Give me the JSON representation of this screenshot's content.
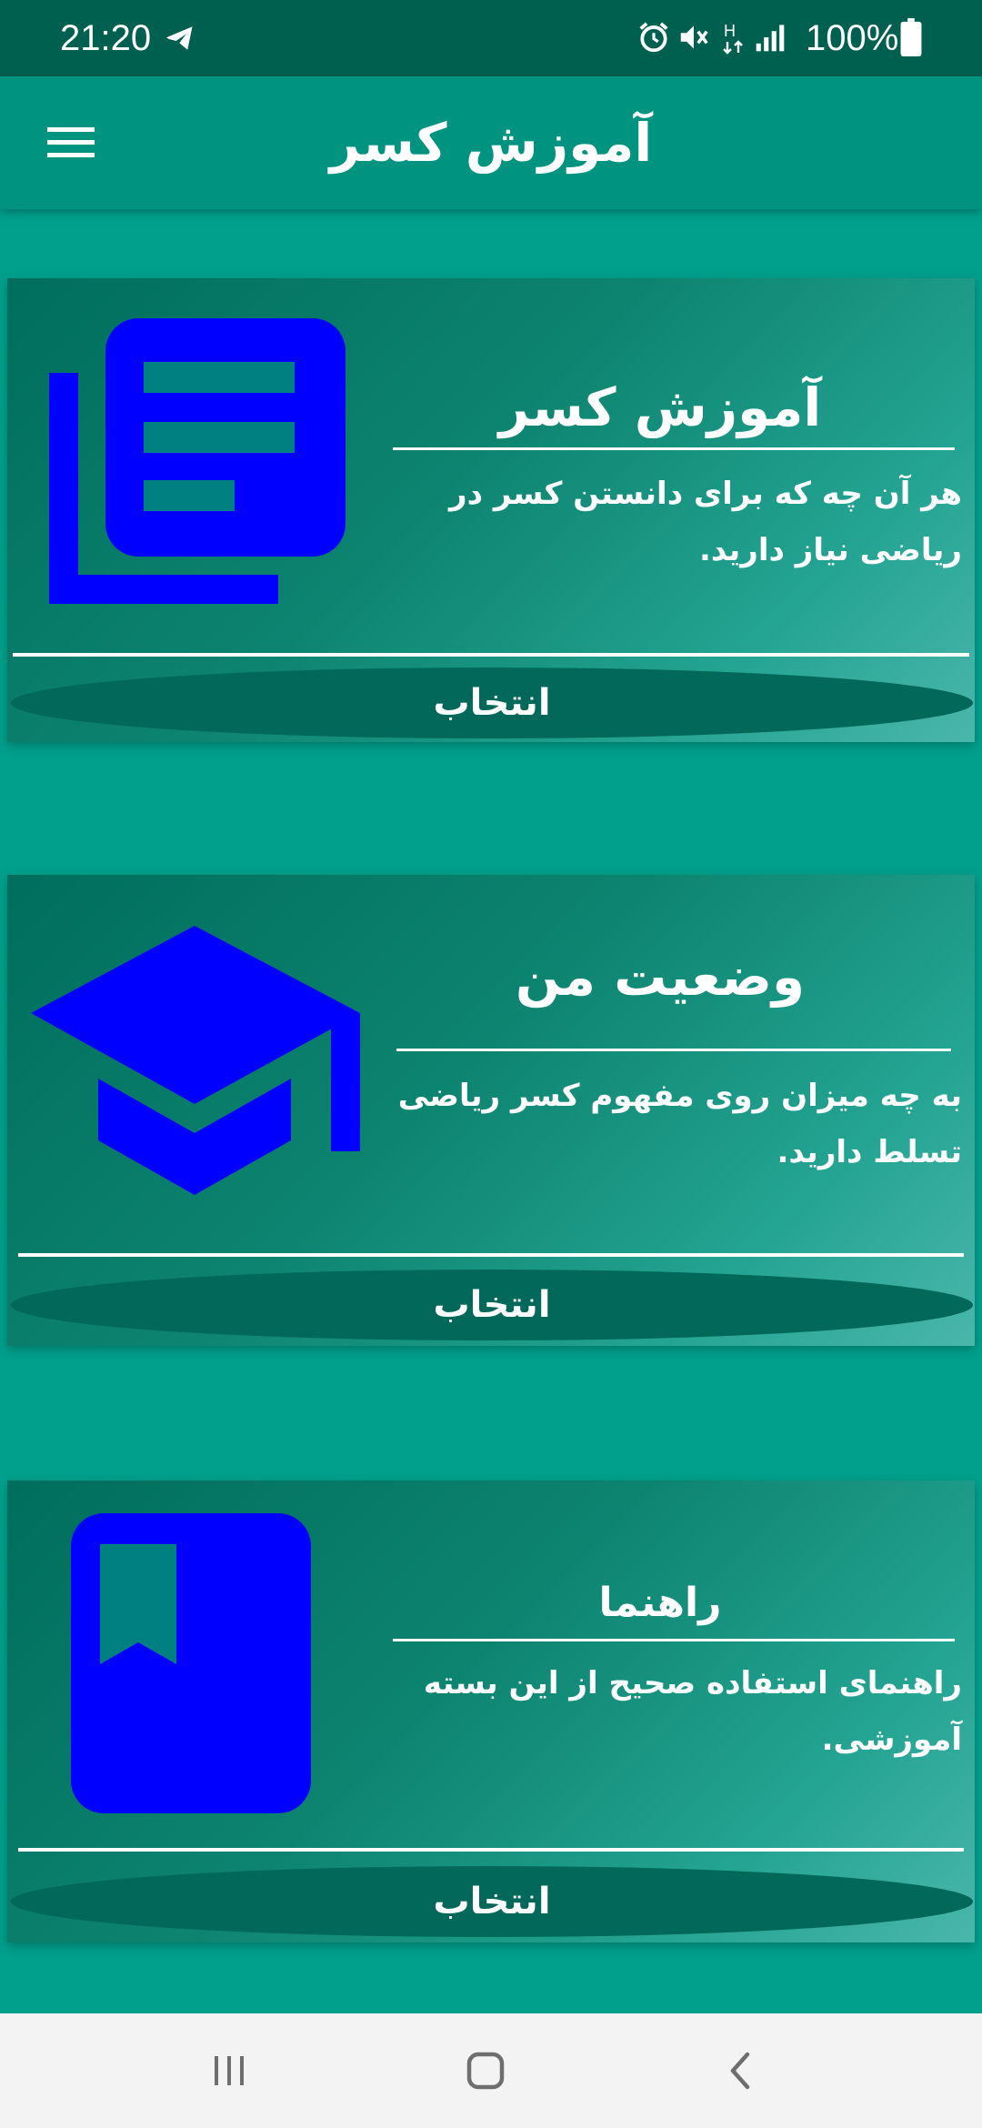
{
  "status_bar": {
    "time": "21:20",
    "battery": "100%",
    "icons": [
      "telegram-icon",
      "alarm-icon",
      "mute-icon",
      "network-h-icon",
      "signal-icon",
      "battery-icon"
    ]
  },
  "app_bar": {
    "title": "آموزش کسر",
    "menu_icon": "hamburger-menu-icon"
  },
  "cards": [
    {
      "title": "آموزش کسر",
      "description": "هر آن چه که برای دانستن کسر در ریاضی نیاز دارید.",
      "button_label": "انتخاب",
      "icon": "library-books-icon"
    },
    {
      "title": "وضعیت من",
      "description": "به چه میزان روی مفهوم کسر ریاضی تسلط دارید.",
      "button_label": "انتخاب",
      "icon": "graduation-cap-icon"
    },
    {
      "title": "راهنما",
      "description": "راهنمای استفاده صحیح از این بسته آموزشی.",
      "button_label": "انتخاب",
      "icon": "bookmark-book-icon"
    }
  ],
  "nav_bar": {
    "buttons": [
      "recent-apps-icon",
      "home-icon",
      "back-icon"
    ]
  },
  "colors": {
    "background": "#00a08c",
    "status_bar": "#00604f",
    "app_bar": "#009380",
    "icon_blue": "#0000ff",
    "button_ellipse": "#02695a",
    "nav_bar": "#f3f3f3"
  }
}
